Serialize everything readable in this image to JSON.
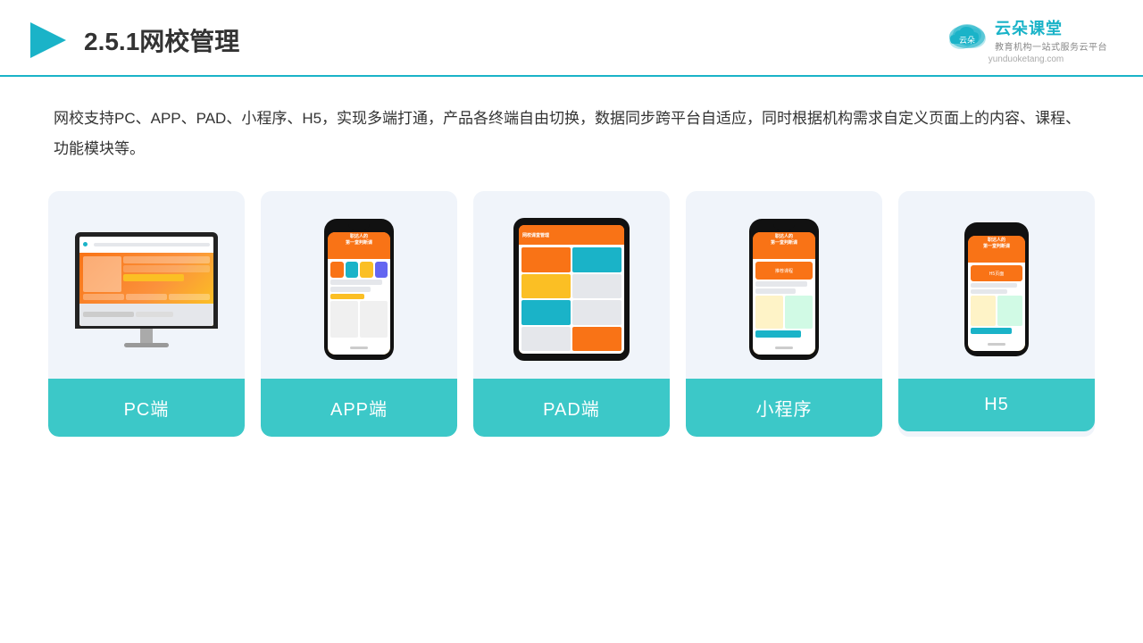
{
  "header": {
    "title": "2.5.1网校管理",
    "brand": {
      "name": "云朵课堂",
      "subtitle": "教育机构一站式服务云平台",
      "url": "yunduoketang.com"
    }
  },
  "description": "网校支持PC、APP、PAD、小程序、H5，实现多端打通，产品各终端自由切换，数据同步跨平台自适应，同时根据机构需求自定义页面上的内容、课程、功能模块等。",
  "cards": [
    {
      "id": "pc",
      "label": "PC端",
      "device": "monitor"
    },
    {
      "id": "app",
      "label": "APP端",
      "device": "phone"
    },
    {
      "id": "pad",
      "label": "PAD端",
      "device": "tablet"
    },
    {
      "id": "miniapp",
      "label": "小程序",
      "device": "phone"
    },
    {
      "id": "h5",
      "label": "H5",
      "device": "phone-mini"
    }
  ],
  "accent_color": "#3cc8c8",
  "phone_text_line1": "职达人的",
  "phone_text_line2": "第一堂判断课"
}
